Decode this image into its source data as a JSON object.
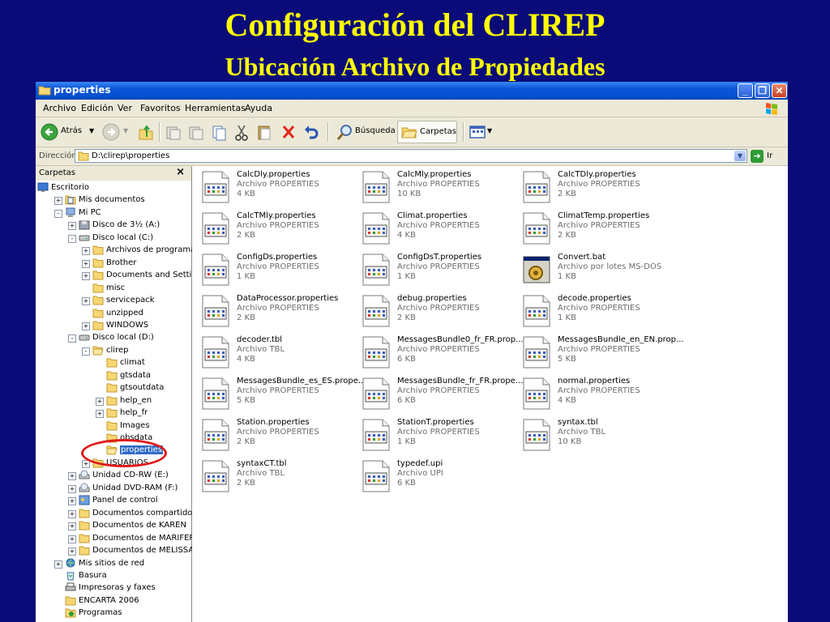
{
  "slide": {
    "title": "Configuración del CLIREP",
    "subtitle": "Ubicación Archivo de Propiedades"
  },
  "window": {
    "title": "properties",
    "menu": [
      "Archivo",
      "Edición",
      "Ver",
      "Favoritos",
      "Herramientas",
      "Ayuda"
    ],
    "toolbar": {
      "back_label": "Atrás",
      "search_label": "Búsqueda",
      "folders_label": "Carpetas"
    },
    "address": {
      "label": "Dirección",
      "value": "D:\\clirep\\properties",
      "go_label": "Ir"
    }
  },
  "folder_pane": {
    "header": "Carpetas",
    "close": "×",
    "items": [
      {
        "label": "Escritorio",
        "icon": "desktop-icon"
      },
      {
        "label": "Mis documentos",
        "icon": "my-documents-icon",
        "exp": "+"
      },
      {
        "label": "Mi PC",
        "icon": "my-computer-icon",
        "exp": "−"
      },
      {
        "label": "Disco de 3½ (A:)",
        "icon": "floppy-icon",
        "exp": "+"
      },
      {
        "label": "Disco local (C:)",
        "icon": "drive-icon",
        "exp": "−"
      },
      {
        "label": "Archivos de programa",
        "icon": "folder-icon",
        "exp": "+"
      },
      {
        "label": "Brother",
        "icon": "folder-icon",
        "exp": "+"
      },
      {
        "label": "Documents and Settings",
        "icon": "folder-icon",
        "exp": "+"
      },
      {
        "label": "misc",
        "icon": "folder-icon"
      },
      {
        "label": "servicepack",
        "icon": "folder-icon",
        "exp": "+"
      },
      {
        "label": "unzipped",
        "icon": "folder-icon"
      },
      {
        "label": "WINDOWS",
        "icon": "folder-icon",
        "exp": "+"
      },
      {
        "label": "Disco local (D:)",
        "icon": "drive-icon",
        "exp": "−"
      },
      {
        "label": "clirep",
        "icon": "folder-open-icon",
        "exp": "−"
      },
      {
        "label": "climat",
        "icon": "folder-icon"
      },
      {
        "label": "gtsdata",
        "icon": "folder-icon"
      },
      {
        "label": "gtsoutdata",
        "icon": "folder-icon"
      },
      {
        "label": "help_en",
        "icon": "folder-icon",
        "exp": "+"
      },
      {
        "label": "help_fr",
        "icon": "folder-icon",
        "exp": "+"
      },
      {
        "label": "Images",
        "icon": "folder-icon"
      },
      {
        "label": "obsdata",
        "icon": "folder-icon"
      },
      {
        "label": "properties",
        "icon": "folder-open-icon",
        "selected": true
      },
      {
        "label": "USUARIOS",
        "icon": "folder-icon",
        "exp": "+"
      },
      {
        "label": "Unidad CD-RW (E:)",
        "icon": "cd-drive-icon",
        "exp": "+"
      },
      {
        "label": "Unidad DVD-RAM (F:)",
        "icon": "cd-drive-icon",
        "exp": "+"
      },
      {
        "label": "Panel de control",
        "icon": "control-panel-icon",
        "exp": "+"
      },
      {
        "label": "Documentos compartidos",
        "icon": "folder-icon",
        "exp": "+"
      },
      {
        "label": "Documentos de KAREN",
        "icon": "folder-icon",
        "exp": "+"
      },
      {
        "label": "Documentos de MARIFER",
        "icon": "folder-icon",
        "exp": "+"
      },
      {
        "label": "Documentos de MELISSA",
        "icon": "folder-icon",
        "exp": "+"
      },
      {
        "label": "Mis sitios de red",
        "icon": "network-icon",
        "exp": "+"
      },
      {
        "label": "Basura",
        "icon": "recycle-bin-icon"
      },
      {
        "label": "Impresoras y faxes",
        "icon": "printer-icon"
      },
      {
        "label": "ENCARTA 2006",
        "icon": "folder-icon"
      },
      {
        "label": "Programas",
        "icon": "programs-icon"
      }
    ]
  },
  "files": [
    {
      "name": "CalcDly.properties",
      "type": "Archivo PROPERTIES",
      "size": "4 KB",
      "icon": "document-icon"
    },
    {
      "name": "CalcMly.properties",
      "type": "Archivo PROPERTIES",
      "size": "10 KB",
      "icon": "document-icon"
    },
    {
      "name": "CalcTDly.properties",
      "type": "Archivo PROPERTIES",
      "size": "2 KB",
      "icon": "document-icon"
    },
    {
      "name": "CalcTMly.properties",
      "type": "Archivo PROPERTIES",
      "size": "2 KB",
      "icon": "document-icon"
    },
    {
      "name": "Climat.properties",
      "type": "Archivo PROPERTIES",
      "size": "4 KB",
      "icon": "document-icon"
    },
    {
      "name": "ClimatTemp.properties",
      "type": "Archivo PROPERTIES",
      "size": "2 KB",
      "icon": "document-icon"
    },
    {
      "name": "ConfigDs.properties",
      "type": "Archivo PROPERTIES",
      "size": "1 KB",
      "icon": "document-icon"
    },
    {
      "name": "ConfigDsT.properties",
      "type": "Archivo PROPERTIES",
      "size": "1 KB",
      "icon": "document-icon"
    },
    {
      "name": "Convert.bat",
      "type": "Archivo por lotes MS-DOS",
      "size": "1 KB",
      "icon": "batch-file-icon"
    },
    {
      "name": "DataProcessor.properties",
      "type": "Archivo PROPERTIES",
      "size": "2 KB",
      "icon": "document-icon"
    },
    {
      "name": "debug.properties",
      "type": "Archivo PROPERTIES",
      "size": "2 KB",
      "icon": "document-icon"
    },
    {
      "name": "decode.properties",
      "type": "Archivo PROPERTIES",
      "size": "1 KB",
      "icon": "document-icon"
    },
    {
      "name": "decoder.tbl",
      "type": "Archivo TBL",
      "size": "4 KB",
      "icon": "document-icon"
    },
    {
      "name": "MessagesBundle0_fr_FR.prop...",
      "type": "Archivo PROPERTIES",
      "size": "6 KB",
      "icon": "document-icon"
    },
    {
      "name": "MessagesBundle_en_EN.prop...",
      "type": "Archivo PROPERTIES",
      "size": "5 KB",
      "icon": "document-icon"
    },
    {
      "name": "MessagesBundle_es_ES.prope...",
      "type": "Archivo PROPERTIES",
      "size": "5 KB",
      "icon": "document-icon"
    },
    {
      "name": "MessagesBundle_fr_FR.prope...",
      "type": "Archivo PROPERTIES",
      "size": "6 KB",
      "icon": "document-icon"
    },
    {
      "name": "normal.properties",
      "type": "Archivo PROPERTIES",
      "size": "4 KB",
      "icon": "document-icon"
    },
    {
      "name": "Station.properties",
      "type": "Archivo PROPERTIES",
      "size": "2 KB",
      "icon": "document-icon"
    },
    {
      "name": "StationT.properties",
      "type": "Archivo PROPERTIES",
      "size": "1 KB",
      "icon": "document-icon"
    },
    {
      "name": "syntax.tbl",
      "type": "Archivo TBL",
      "size": "10 KB",
      "icon": "document-icon"
    },
    {
      "name": "syntaxCT.tbl",
      "type": "Archivo TBL",
      "size": "2 KB",
      "icon": "document-icon"
    },
    {
      "name": "typedef.upi",
      "type": "Archivo UPI",
      "size": "6 KB",
      "icon": "document-icon"
    }
  ],
  "colors": {
    "slide_background": "#0a0a78",
    "slide_title": "#ffff00",
    "selection": "#316ac5",
    "highlight_circle": "#e01b1b"
  }
}
